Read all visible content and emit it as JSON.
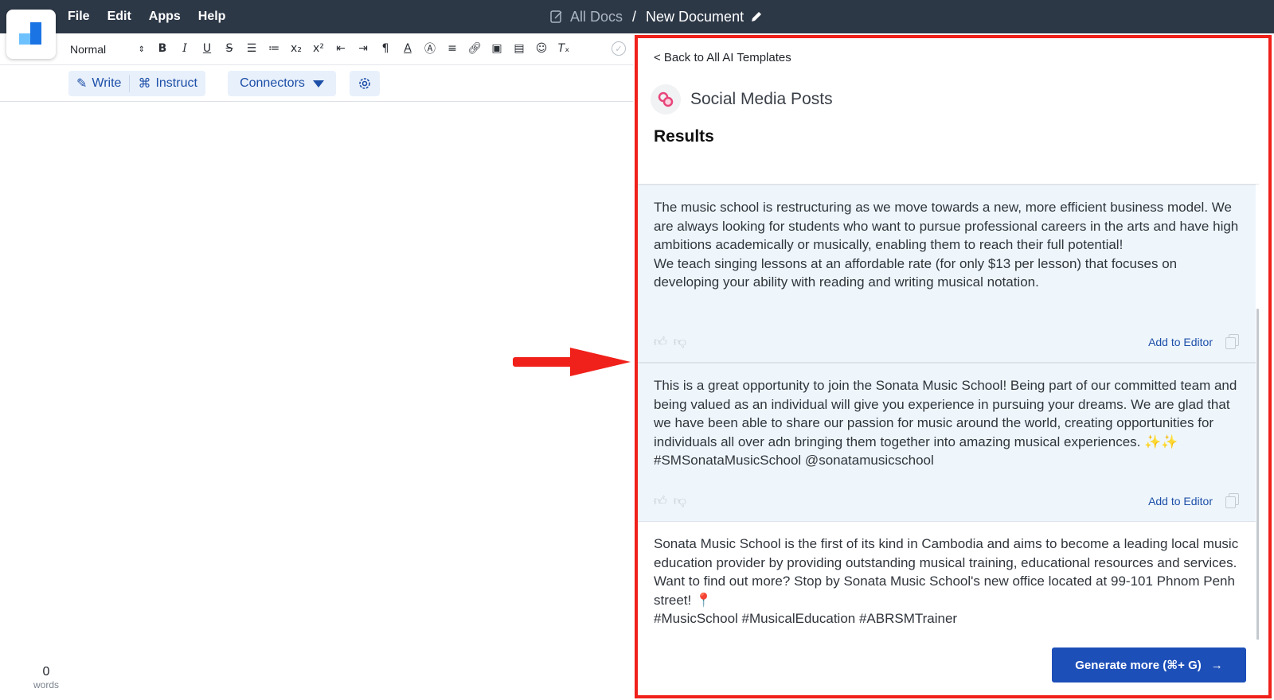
{
  "menu": {
    "file": "File",
    "edit": "Edit",
    "apps": "Apps",
    "help": "Help"
  },
  "breadcrumb": {
    "all_docs": "All Docs",
    "separator": "/",
    "document_name": "New Document"
  },
  "toolbar": {
    "style_value": "Normal",
    "tools": [
      "bold",
      "italic",
      "underline",
      "strikethrough",
      "ordered-list",
      "bullet-list",
      "subscript",
      "superscript",
      "outdent",
      "indent",
      "text-direction",
      "font-color",
      "highlight",
      "align",
      "link",
      "image",
      "video",
      "emoji",
      "clear-format"
    ]
  },
  "actions": {
    "write": "Write",
    "instruct": "Instruct",
    "connectors": "Connectors"
  },
  "word_count": {
    "value": "0",
    "label": "words"
  },
  "panel": {
    "back_link": "< Back to All AI Templates",
    "template_name": "Social Media Posts",
    "results_heading": "Results",
    "results": [
      {
        "text": "The music school is restructuring as we move towards a new, more efficient business model. We are always looking for students who want to pursue professional careers in the arts and have high ambitions academically or musically, enabling them to reach their full potential!\nWe teach singing lessons at an affordable rate (for only $13 per lesson) that focuses on developing your ability with reading and writing musical notation.",
        "add_label": "Add to Editor"
      },
      {
        "text": "This is a great opportunity to join the Sonata Music School! Being part of our committed team and being valued as an individual will give you experience in pursuing your dreams. We are glad that we have been able to share our passion for music around the world, creating opportunities for individuals all over adn bringing them together into amazing musical experiences. ✨✨ #SMSonataMusicSchool @sonatamusicschool",
        "add_label": "Add to Editor"
      },
      {
        "text": "Sonata Music School is the first of its kind in Cambodia and aims to become a leading local music education provider by providing outstanding musical training, educational resources and services.\nWant to find out more? Stop by Sonata Music School's new office located at 99-101 Phnom Penh street! 📍\n#MusicSchool #MusicalEducation #ABRSMTrainer"
      }
    ],
    "generate_label": "Generate more (⌘+ G)",
    "generate_arrow": "→"
  },
  "colors": {
    "topbar": "#2d3847",
    "accent": "#1d4fb8",
    "highlight_border": "#f0201a",
    "card_bg": "#eef6fc"
  }
}
